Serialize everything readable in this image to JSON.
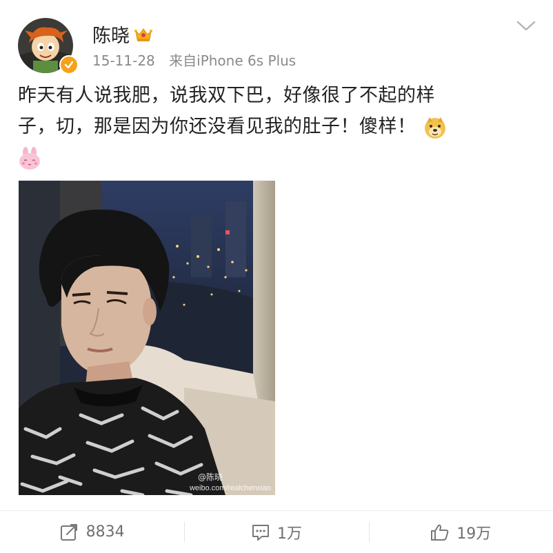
{
  "user": {
    "name": "陈晓",
    "date": "15-11-28",
    "source": "来自iPhone 6s Plus"
  },
  "post": {
    "lines": [
      "昨天有人说我肥，说我双下巴，好像很了不起的样",
      "子，切，那是因为你还没看见我的肚子！傻样！"
    ],
    "photo_watermark": "weibo.com/realchenxiao",
    "photo_watermark_logo": "@陈晓"
  },
  "actions": {
    "repost_count": "8834",
    "comment_count": "1万",
    "like_count": "19万"
  },
  "icons": {
    "verified": "verified-badge-icon",
    "crown": "crown-vip-icon",
    "chevron": "chevron-down-icon",
    "emoji_doge": "doge-emoji-icon",
    "emoji_rabbit": "rabbit-emoji-icon",
    "repost": "repost-icon",
    "comment": "comment-icon",
    "like": "thumbs-up-icon"
  },
  "colors": {
    "verified_badge": "#f4a21b",
    "meta_text": "#8a8a8a",
    "action_text": "#6f6f6f"
  }
}
